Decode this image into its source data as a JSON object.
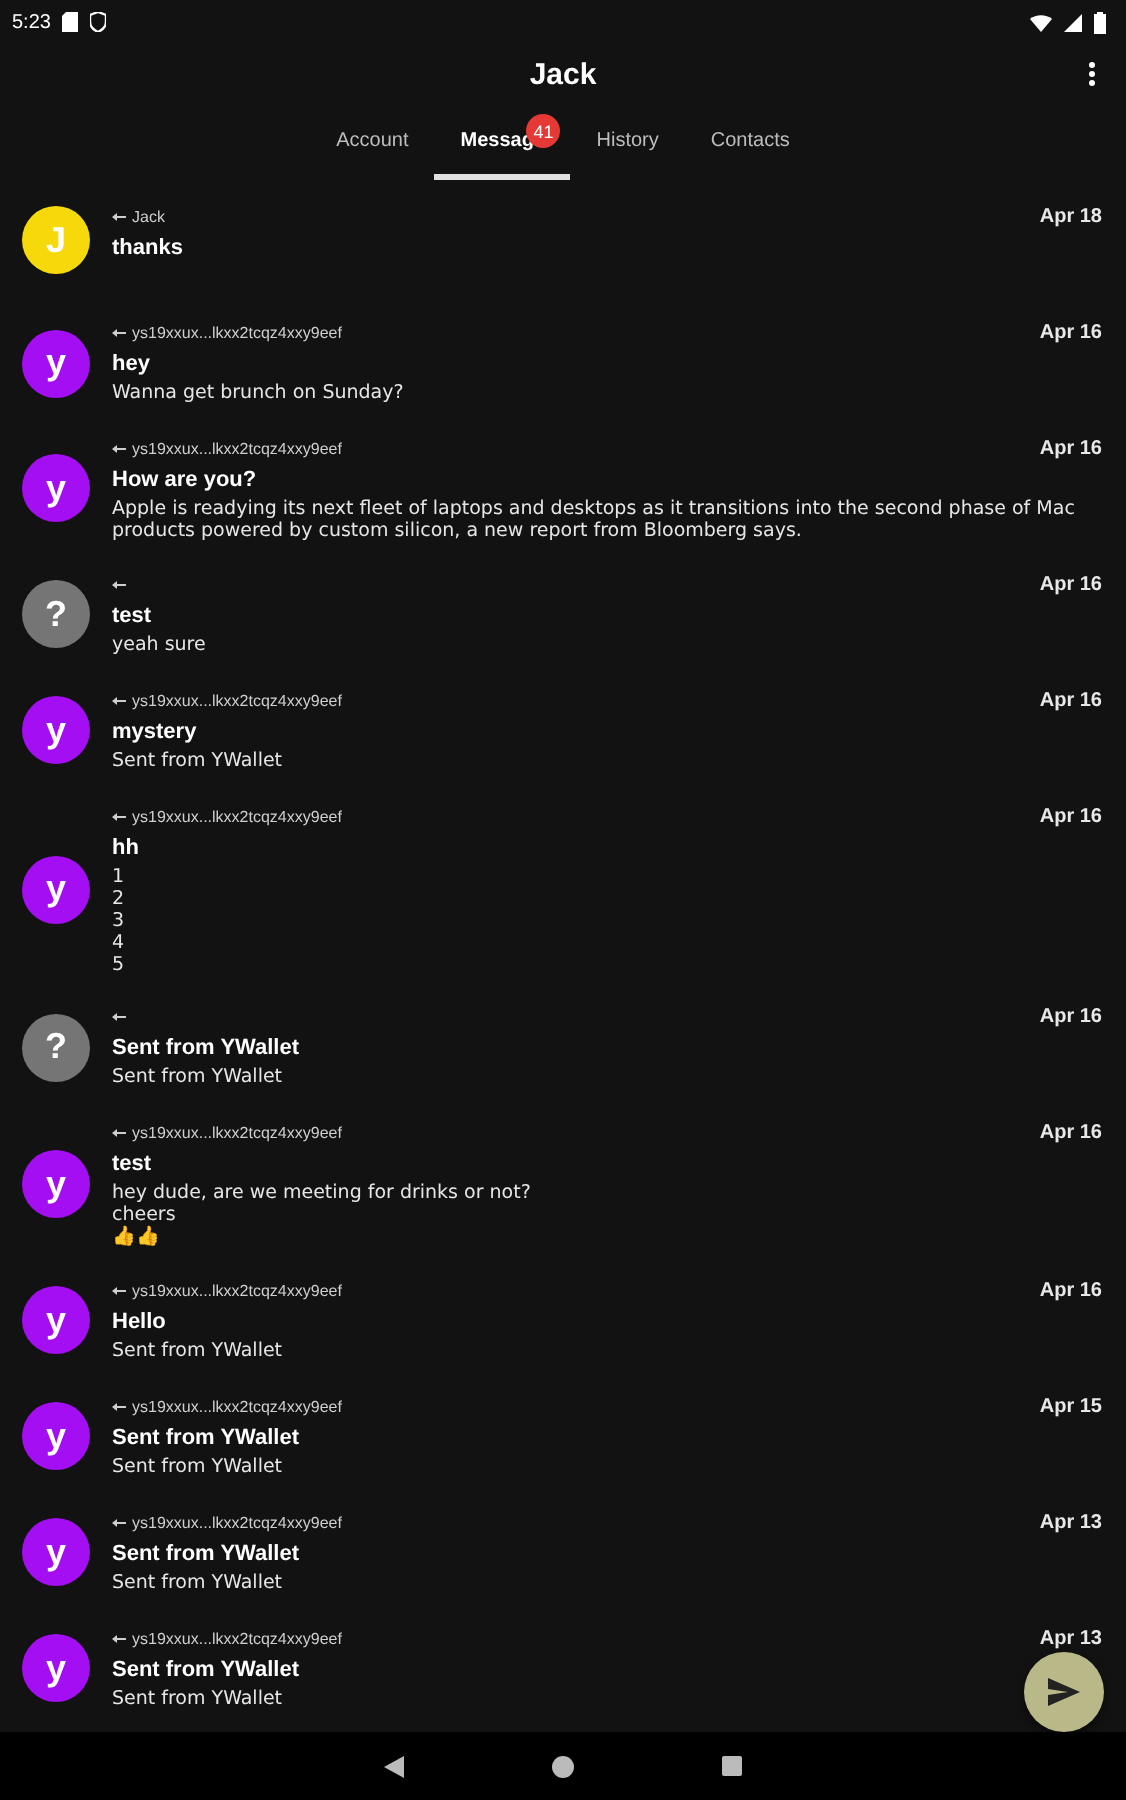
{
  "status_bar": {
    "time": "5:23"
  },
  "header": {
    "title": "Jack"
  },
  "tabs": [
    {
      "label": "Account",
      "selected": false
    },
    {
      "label": "Messag",
      "selected": true,
      "badge": "41"
    },
    {
      "label": "History",
      "selected": false
    },
    {
      "label": "Contacts",
      "selected": false
    }
  ],
  "messages": [
    {
      "avatar": {
        "letter": "J",
        "color": "#f5d90a"
      },
      "sender": "Jack",
      "date": "Apr 18",
      "subject": "thanks"
    },
    {
      "avatar": {
        "letter": "y",
        "color": "#a40ef2"
      },
      "sender": "ys19xxux...lkxx2tcqz4xxy9eef",
      "date": "Apr 16",
      "subject": "hey",
      "body": "Wanna get brunch on Sunday?"
    },
    {
      "avatar": {
        "letter": "y",
        "color": "#a40ef2"
      },
      "sender": "ys19xxux...lkxx2tcqz4xxy9eef",
      "date": "Apr 16",
      "subject": "How are you?",
      "body": "Apple is readying its next fleet of laptops and desktops as it transitions into the second phase of Mac products powered by custom silicon, a new report from Bloomberg says."
    },
    {
      "avatar": {
        "letter": "?",
        "color": "#757575"
      },
      "date": "Apr 16",
      "subject": "test",
      "body": "yeah sure"
    },
    {
      "avatar": {
        "letter": "y",
        "color": "#a40ef2"
      },
      "sender": "ys19xxux...lkxx2tcqz4xxy9eef",
      "date": "Apr 16",
      "subject": "mystery",
      "body": "Sent from YWallet"
    },
    {
      "avatar": {
        "letter": "y",
        "color": "#a40ef2"
      },
      "sender": "ys19xxux...lkxx2tcqz4xxy9eef",
      "date": "Apr 16",
      "subject": "hh",
      "body": "1\n2\n3\n4\n5"
    },
    {
      "avatar": {
        "letter": "?",
        "color": "#757575"
      },
      "date": "Apr 16",
      "subject": "Sent from YWallet",
      "body": "Sent from YWallet"
    },
    {
      "avatar": {
        "letter": "y",
        "color": "#a40ef2"
      },
      "sender": "ys19xxux...lkxx2tcqz4xxy9eef",
      "date": "Apr 16",
      "subject": "test",
      "body": "hey dude, are we meeting for drinks or not?\ncheers\n👍👍"
    },
    {
      "avatar": {
        "letter": "y",
        "color": "#a40ef2"
      },
      "sender": "ys19xxux...lkxx2tcqz4xxy9eef",
      "date": "Apr 16",
      "subject": "Hello",
      "body": "Sent from YWallet"
    },
    {
      "avatar": {
        "letter": "y",
        "color": "#a40ef2"
      },
      "sender": "ys19xxux...lkxx2tcqz4xxy9eef",
      "date": "Apr 15",
      "subject": "Sent from YWallet",
      "body": "Sent from YWallet"
    },
    {
      "avatar": {
        "letter": "y",
        "color": "#a40ef2"
      },
      "sender": "ys19xxux...lkxx2tcqz4xxy9eef",
      "date": "Apr 13",
      "subject": "Sent from YWallet",
      "body": "Sent from YWallet"
    },
    {
      "avatar": {
        "letter": "y",
        "color": "#a40ef2"
      },
      "sender": "ys19xxux...lkxx2tcqz4xxy9eef",
      "date": "Apr 13",
      "subject": "Sent from YWallet",
      "body": "Sent from YWallet"
    }
  ]
}
